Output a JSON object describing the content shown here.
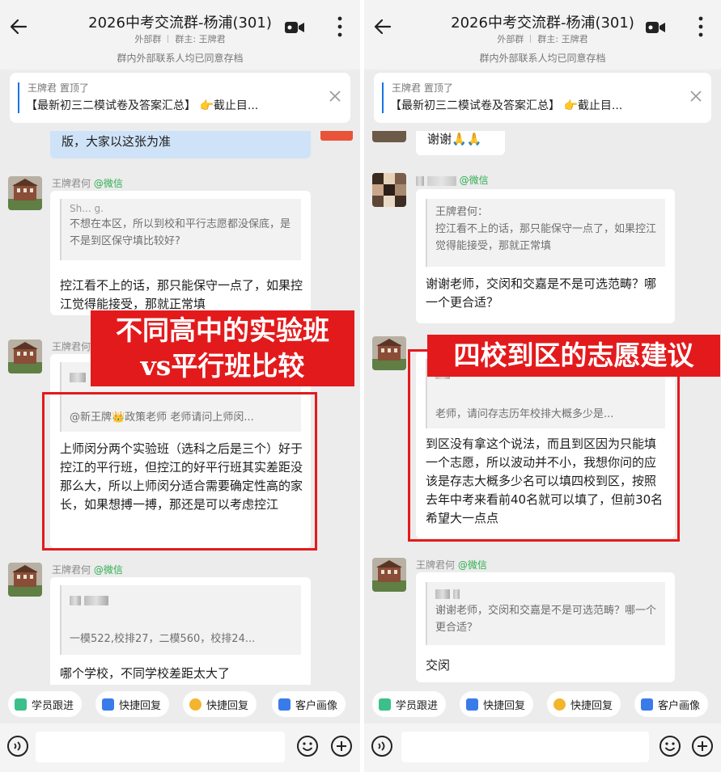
{
  "left": {
    "header": {
      "title": "2026中考交流群-杨浦(301)",
      "group_type": "外部群",
      "owner": "群主: 王牌君",
      "archive_notice": "群内外部联系人均已同意存档"
    },
    "pinned": {
      "by": "王牌君 置顶了",
      "text": "【最新初三二模试卷及答案汇总】 👉截止目..."
    },
    "messages": {
      "top_partial": "版，大家以这张为准",
      "m1_sender": "王牌君何",
      "m1_source": "@微信",
      "m1_quote_name": "Sh... g.",
      "m1_quote": "不想在本区，所以到校和平行志愿都没保底，是不是到区保守填比较好?",
      "m1_text": "控江看不上的话，那只能保守一点了，如果控江觉得能接受，那就正常填",
      "m2_sender": "王牌君何",
      "m2_quote": "@新王牌👑政策老师 老师请问上师闵...",
      "m2_text": "上师闵分两个实验班（选科之后是三个）好于控江的平行班，但控江的好平行班其实差距没那么大，所以上师闵分适合需要确定性高的家长，如果想搏一搏，那还是可以考虑控江",
      "m3_sender": "王牌君何",
      "m3_source": "@微信",
      "m3_quote": "一模522,校排27，二模560，校排24...",
      "m3_text": "哪个学校，不同学校差距太大了"
    },
    "banner": [
      "不同高中的实验班",
      "vs平行班比较"
    ],
    "quick": [
      "学员跟进",
      "快捷回复",
      "快捷回复",
      "客户画像"
    ]
  },
  "right": {
    "header": {
      "title": "2026中考交流群-杨浦(301)",
      "group_type": "外部群",
      "owner": "群主: 王牌君",
      "archive_notice": "群内外部联系人均已同意存档"
    },
    "pinned": {
      "by": "王牌君 置顶了",
      "text": "【最新初三二模试卷及答案汇总】 👉截止目..."
    },
    "messages": {
      "top_partial": "谢谢🙏🙏",
      "r1_source": "@微信",
      "r1_quote": "王牌君何：\n控江看不上的话，那只能保守一点了，如果控江觉得能接受，那就正常填",
      "r1_text": "谢谢老师，交闵和交嘉是不是可选范畴？哪一个更合适？",
      "r2_quote": "老师，请问存志历年校排大概多少是...",
      "r2_text": "到区没有拿这个说法，而且到区因为只能填一个志愿，所以波动并不小，我想你问的应该是存志大概多少名可以填四校到区，按照去年中考来看前40名就可以填了，但前30名希望大一点点",
      "r3_sender": "王牌君何",
      "r3_source": "@微信",
      "r3_quote": "谢谢老师，交闵和交嘉是不是可选范畴？哪一个更合适？",
      "r3_text": "交闵"
    },
    "banner": "四校到区的志愿建议",
    "quick": [
      "学员跟进",
      "快捷回复",
      "快捷回复",
      "客户画像"
    ]
  },
  "colors": {
    "highlight_red": "#e31a1c",
    "wechat_green": "#2fae50",
    "pin_blue": "#1a73e8"
  }
}
